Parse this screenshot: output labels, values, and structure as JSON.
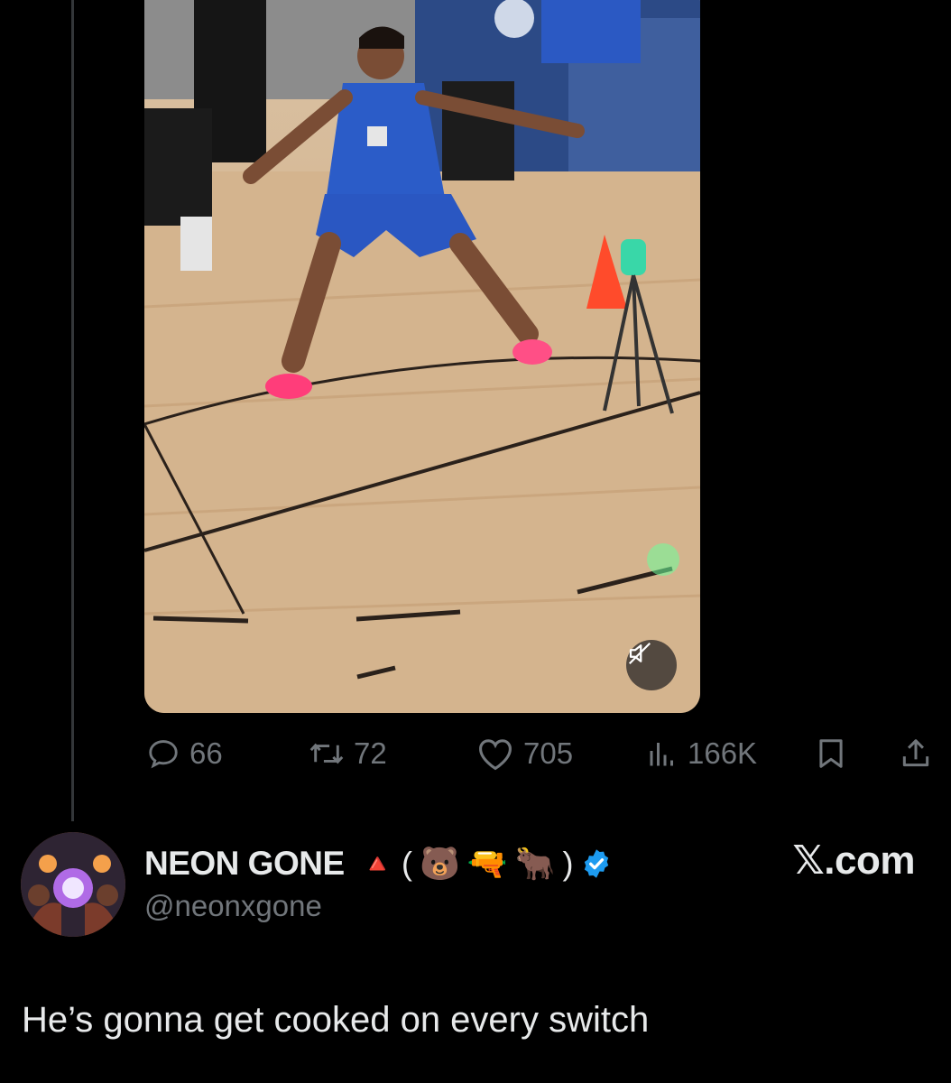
{
  "tweet_actions": {
    "replies": "66",
    "reposts": "72",
    "likes": "705",
    "views": "166K"
  },
  "author": {
    "display_name": "NEON GONE",
    "name_suffix_emojis": [
      "🔺",
      "(",
      "🐻",
      "🔫",
      "🐂",
      ")"
    ],
    "handle": "@neonxgone",
    "verified": true
  },
  "source": "𝕏.com",
  "post": {
    "text": "He’s gonna get cooked on every switch"
  },
  "colors": {
    "background": "#000000",
    "text_primary": "#e7e9ea",
    "text_secondary": "#71767b",
    "verified_blue": "#1d9bf0"
  },
  "icons": [
    "reply-icon",
    "repost-icon",
    "like-icon",
    "views-icon",
    "bookmark-icon",
    "share-icon",
    "mute-icon",
    "verified-badge-icon"
  ]
}
